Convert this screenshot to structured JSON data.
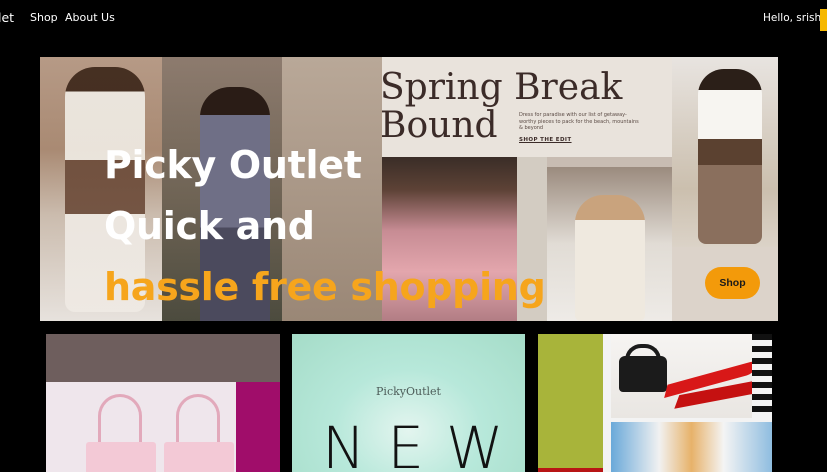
{
  "nav": {
    "brand": "let",
    "links": [
      {
        "label": "Shop"
      },
      {
        "label": "About Us"
      }
    ],
    "greeting": "Hello, srishti",
    "accent_color": "#f6b800"
  },
  "hero": {
    "magazine": {
      "title_line1": "Spring Break",
      "title_line2": "Bound",
      "blurb": "Dress for paradise with our list of getaway-worthy pieces to pack for the beach, mountains & beyond",
      "cta": "SHOP THE EDIT"
    },
    "heading_line1": "Picky Outlet",
    "heading_line2": "Quick and",
    "heading_line3": "hassle free shopping",
    "accent_color": "#f6a51c",
    "button_label": "Shop"
  },
  "cards": [
    {
      "name": "shopping-bags-card"
    },
    {
      "name": "new-arrivals-card",
      "brand": "PickyOutlet",
      "text": "NEW"
    },
    {
      "name": "accessories-card"
    }
  ]
}
